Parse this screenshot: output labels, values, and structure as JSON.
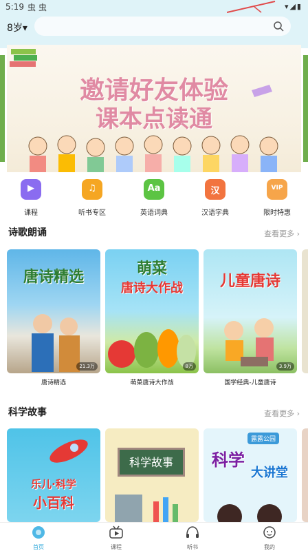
{
  "status_bar": {
    "time": "5:19",
    "bug1": "虫",
    "bug2": "虫",
    "icons": "▾◢▮"
  },
  "header": {
    "age_selector": "8岁▾",
    "search_placeholder": ""
  },
  "banner": {
    "line1": "邀请好友体验",
    "line2": "课本点读通"
  },
  "quick_menu": [
    {
      "label": "课程",
      "icon": "video-icon",
      "color": "#8a6cf0",
      "glyph": "▶"
    },
    {
      "label": "听书专区",
      "icon": "headphones-icon",
      "color": "#f5a623",
      "glyph": "♫"
    },
    {
      "label": "英语词典",
      "icon": "dictionary-icon",
      "color": "#5cc443",
      "glyph": "Aa"
    },
    {
      "label": "汉语字典",
      "icon": "character-icon",
      "color": "#f2743f",
      "glyph": "汉"
    },
    {
      "label": "限时特惠",
      "icon": "vip-icon",
      "color": "#f6a54a",
      "glyph": "VIP"
    }
  ],
  "sections": {
    "poetry": {
      "title": "诗歌朗诵",
      "more": "查看更多 ›",
      "cards": [
        {
          "title": "唐诗精选",
          "cover": "唐诗精选",
          "plays": "21.3万"
        },
        {
          "title": "萌菜唐诗大作战",
          "cover_line1": "萌菜",
          "cover_line2": "唐诗大作战",
          "plays": "8万"
        },
        {
          "title": "国学经典-儿童唐诗",
          "cover": "儿童唐诗",
          "plays": "3.9万"
        }
      ]
    },
    "science": {
      "title": "科学故事",
      "more": "查看更多 ›",
      "cards": [
        {
          "cover_line1": "乐儿·科学",
          "cover_line2": "小百科"
        },
        {
          "cover": "科学故事"
        },
        {
          "cover_line1": "科学",
          "cover_line2": "大讲堂",
          "tag": "露露公园"
        }
      ]
    }
  },
  "tabs": [
    {
      "label": "首页",
      "icon": "home-icon",
      "active": true
    },
    {
      "label": "课程",
      "icon": "tv-icon",
      "active": false
    },
    {
      "label": "听书",
      "icon": "headphones-icon",
      "active": false
    },
    {
      "label": "我的",
      "icon": "profile-icon",
      "active": false
    }
  ]
}
